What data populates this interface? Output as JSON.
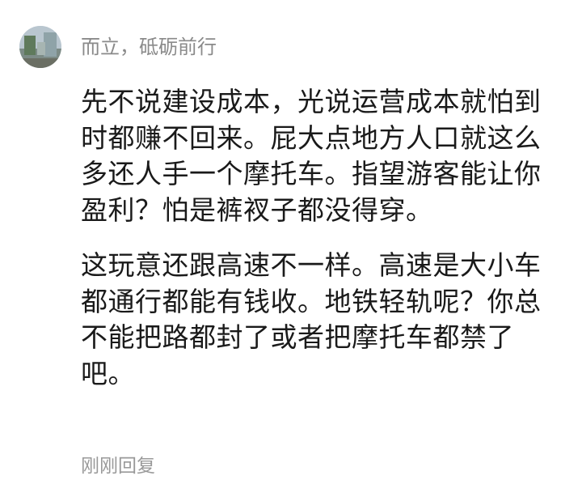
{
  "comment": {
    "username": "而立，砥砺前行",
    "avatar_icon": "user-avatar",
    "paragraphs": [
      "先不说建设成本，光说运营成本就怕到时都赚不回来。屁大点地方人口就这么多还人手一个摩托车。指望游客能让你盈利？怕是裤衩子都没得穿。",
      "这玩意还跟高速不一样。高速是大小车都通行都能有钱收。地铁轻轨呢？你总不能把路都封了或者把摩托车都禁了吧。"
    ],
    "reply_time": "刚刚回复"
  },
  "colors": {
    "username": "#8a8a8a",
    "body_text": "#1a1a1a",
    "meta_text": "#999999"
  }
}
